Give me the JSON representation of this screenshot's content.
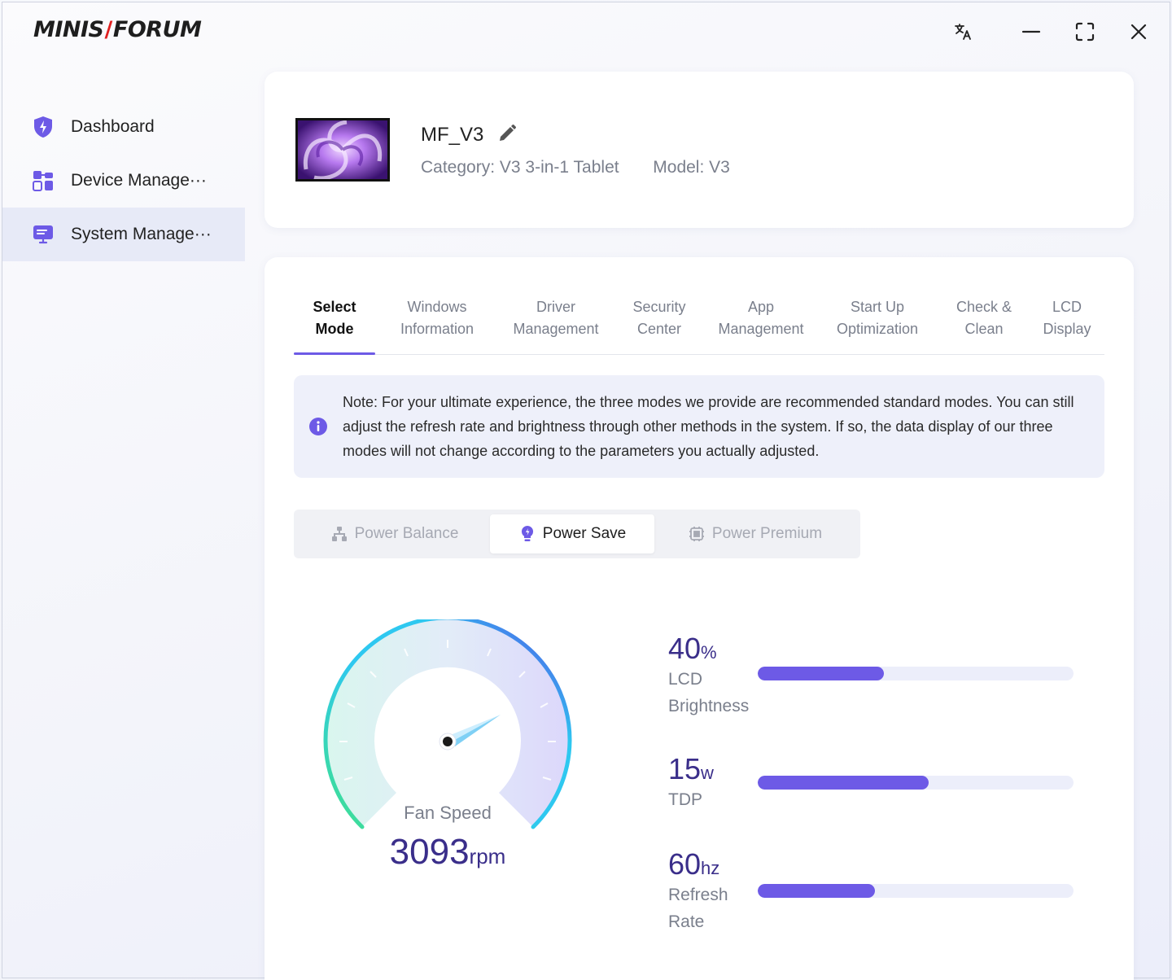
{
  "app": {
    "logo_left": "MINIS",
    "logo_right": "FORUM",
    "title_buttons": [
      "translate-icon",
      "minimize-icon",
      "maximize-icon",
      "close-icon"
    ]
  },
  "sidebar": {
    "items": [
      {
        "label": "Dashboard",
        "icon": "shield-bolt-icon",
        "active": false
      },
      {
        "label": "Device Manage···",
        "icon": "device-blocks-icon",
        "active": false
      },
      {
        "label": "System Manage···",
        "icon": "monitor-icon",
        "active": true
      }
    ]
  },
  "device": {
    "name": "MF_V3",
    "category": "Category: V3 3-in-1 Tablet",
    "model": "Model: V3"
  },
  "tabs": [
    {
      "label": "Select\nMode",
      "active": true
    },
    {
      "label": "Windows\nInformation",
      "active": false
    },
    {
      "label": "Driver\nManagement",
      "active": false
    },
    {
      "label": "Security\nCenter",
      "active": false
    },
    {
      "label": "App\nManagement",
      "active": false
    },
    {
      "label": "Start Up\nOptimization",
      "active": false
    },
    {
      "label": "Check &\nClean",
      "active": false
    },
    {
      "label": "LCD\nDisplay",
      "active": false
    }
  ],
  "note": {
    "text": "Note: For your ultimate experience, the three modes we provide are recommended standard modes. You can still adjust the refresh rate and brightness through other methods in the system. If so, the data display of our three modes will not change according to the parameters you actually adjusted."
  },
  "modes": [
    {
      "label": "Power Balance",
      "icon": "network-icon",
      "active": false
    },
    {
      "label": "Power Save",
      "icon": "bulb-icon",
      "active": true
    },
    {
      "label": "Power Premium",
      "icon": "chip-icon",
      "active": false
    }
  ],
  "fan": {
    "label": "Fan Speed",
    "value": "3093",
    "unit": "rpm"
  },
  "stats": [
    {
      "value": "40",
      "unit": "%",
      "label": "LCD Brightness",
      "fill": 0.4
    },
    {
      "value": "15",
      "unit": "w",
      "label": "TDP",
      "fill": 0.54
    },
    {
      "value": "60",
      "unit": "hz",
      "label": "Refresh Rate",
      "fill": 0.37
    }
  ],
  "colors": {
    "accent": "#6d5ae6",
    "value_text": "#3a2e8a",
    "gauge_start": "#3fe08e",
    "gauge_mid": "#2ec8f0",
    "gauge_end": "#5a3ee6"
  }
}
